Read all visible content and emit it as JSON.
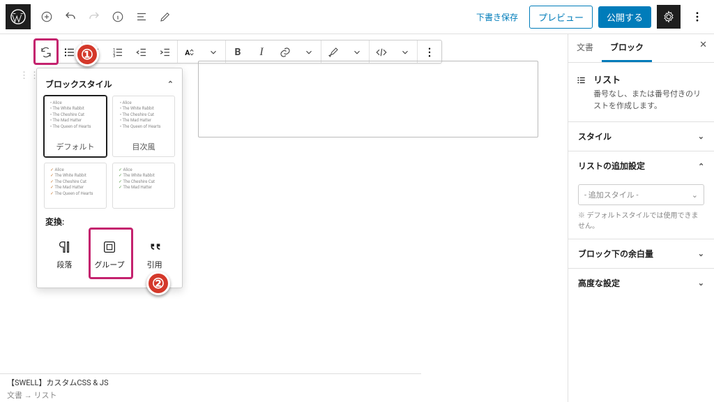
{
  "top": {
    "save_draft": "下書き保存",
    "preview": "プレビュー",
    "publish": "公開する"
  },
  "sidebar": {
    "tab_doc": "文書",
    "tab_block": "ブロック",
    "block_title": "リスト",
    "block_desc": "番号なし、または番号付きのリストを作成します。",
    "panel_style": "スタイル",
    "panel_list_settings": "リストの追加設定",
    "select_placeholder": "- 追加スタイル -",
    "note": "※ デフォルトスタイルでは使用できません。",
    "panel_margin": "ブロック下の余白量",
    "panel_advanced": "高度な設定"
  },
  "popover": {
    "header": "ブロックスタイル",
    "styles": [
      {
        "label": "デフォルト",
        "items": [
          "Alice",
          "The White Rabbit",
          "The Cheshire Cat",
          "The Mad Hatter",
          "The Queen of Hearts"
        ]
      },
      {
        "label": "目次風",
        "items": [
          "Alice",
          "The White Rabbit",
          "The Cheshire Cat",
          "The Mad Hatter",
          "The Queen of Hearts"
        ]
      },
      {
        "label": "",
        "items": [
          "Alice",
          "The White Rabbit",
          "The Cheshire Cat",
          "The Mad Hatter",
          "The Queen of Hearts"
        ]
      },
      {
        "label": "",
        "items": [
          "Alice",
          "The White Rabbit",
          "The Cheshire Cat",
          "The Mad Hatter"
        ]
      }
    ],
    "transform_header": "変換:",
    "transforms": [
      {
        "label": "段落"
      },
      {
        "label": "グループ"
      },
      {
        "label": "引用"
      }
    ]
  },
  "footer": {
    "meta_title": "【SWELL】カスタムCSS & JS",
    "breadcrumb": "文書 → リスト"
  }
}
